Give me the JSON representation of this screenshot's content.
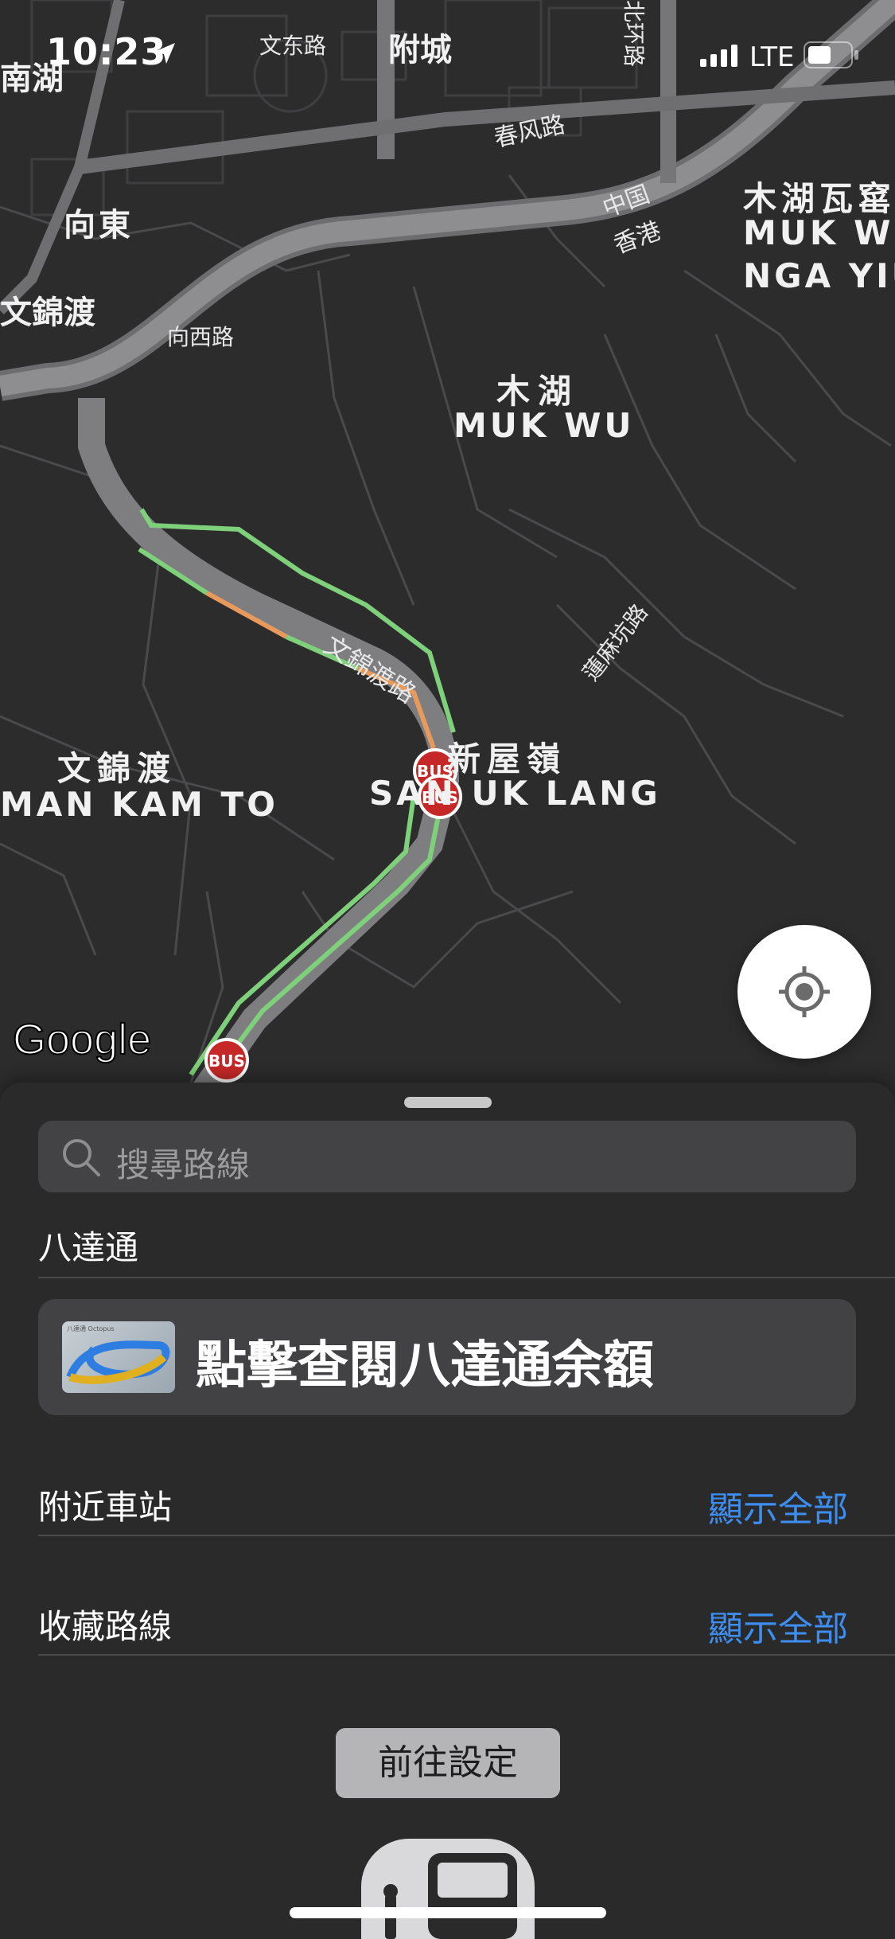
{
  "status_bar": {
    "time": "10:23",
    "network": "LTE"
  },
  "map": {
    "labels": {
      "nam_wu": "南湖",
      "man_tung_road": "文东路",
      "fu_shing": "附城",
      "north_road": "北环路",
      "chun_fung_road": "春风路",
      "china": "中国",
      "hong_kong": "香港",
      "muk_wu_nga_yiu_zh": "木湖瓦窰",
      "muk_wu_nga_yiu_en1": "MUK WU",
      "muk_wu_nga_yiu_en2": "NGA YIU",
      "heung_tung": "向東",
      "man_kam_to_top": "文錦渡",
      "heung_sai_road": "向西路",
      "muk_wu_zh": "木湖",
      "muk_wu_en": "MUK WU",
      "man_kam_to_road": "文錦渡路",
      "lin_ma_hang_road": "蓮麻坑路",
      "man_kam_to_zh": "文錦渡",
      "man_kam_to_en": "MAN KAM TO",
      "san_uk_ling_zh": "新屋嶺",
      "san_uk_ling_en": "SAN UK LANG"
    },
    "bus_stop_label": "BUS",
    "google_logo": "Google"
  },
  "sheet": {
    "search": {
      "placeholder": "搜尋路線"
    },
    "octopus": {
      "title": "八達通",
      "card_label": "點擊查閱八達通余額",
      "card_brand": "八達通 Octopus"
    },
    "nearby": {
      "title": "附近車站",
      "show_all": "顯示全部"
    },
    "favorites": {
      "title": "收藏路線",
      "show_all": "顯示全部"
    },
    "settings_button": "前往設定"
  },
  "colors": {
    "route_green": "#7ed07a",
    "route_orange": "#e89a5c",
    "road_gray": "#8e8e90",
    "link_blue": "#3d8ef0",
    "bus_red": "#c62828"
  }
}
